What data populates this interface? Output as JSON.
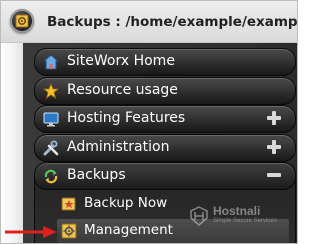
{
  "window": {
    "title": "Backups : /home/example/example.com",
    "icon": "backups-app-icon"
  },
  "menu": {
    "items": [
      {
        "label": "SiteWorx Home",
        "icon": "home-icon"
      },
      {
        "label": "Resource usage",
        "icon": "star-icon"
      },
      {
        "label": "Hosting Features",
        "icon": "monitor-icon",
        "expander": "plus"
      },
      {
        "label": "Administration",
        "icon": "tools-icon",
        "expander": "plus"
      },
      {
        "label": "Backups",
        "icon": "backup-arrows-icon",
        "expander": "minus"
      }
    ],
    "backups_submenu": [
      {
        "label": "Backup Now",
        "icon": "backup-now-icon"
      },
      {
        "label": "Management",
        "icon": "management-gear-icon",
        "active": true
      }
    ]
  },
  "watermark": {
    "brand": "Hostnali",
    "tagline": "Simple Secure Services"
  },
  "colors": {
    "panel": "#2b2b2b",
    "pill_top": "#4a4a4a",
    "pill_bottom": "#181818",
    "annotation_arrow": "#e0201a"
  }
}
